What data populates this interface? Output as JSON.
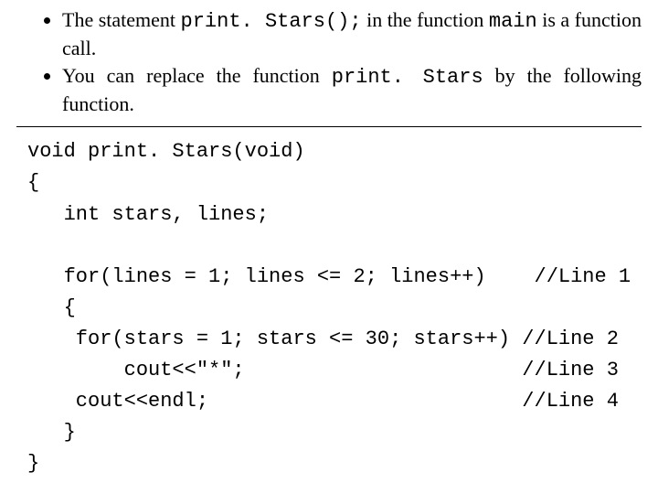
{
  "bullets": {
    "b1_p1": "The statement ",
    "b1_code1": "print. Stars();",
    "b1_p2": " in the function ",
    "b1_code2": "main",
    "b1_p3": " is a function call.",
    "b2_p1": "You can replace the function ",
    "b2_code1": "print. Stars",
    "b2_p2": " by the following function."
  },
  "code": {
    "l1": "void print. Stars(void)",
    "l2": "{",
    "l3": "   int stars, lines;",
    "l4": "",
    "l5": "   for(lines = 1; lines <= 2; lines++)    //Line 1",
    "l6": "   {",
    "l7": "    for(stars = 1; stars <= 30; stars++) //Line 2",
    "l8": "        cout<<\"*\";                       //Line 3",
    "l9": "    cout<<endl;                          //Line 4",
    "l10": "   }",
    "l11": "}"
  }
}
